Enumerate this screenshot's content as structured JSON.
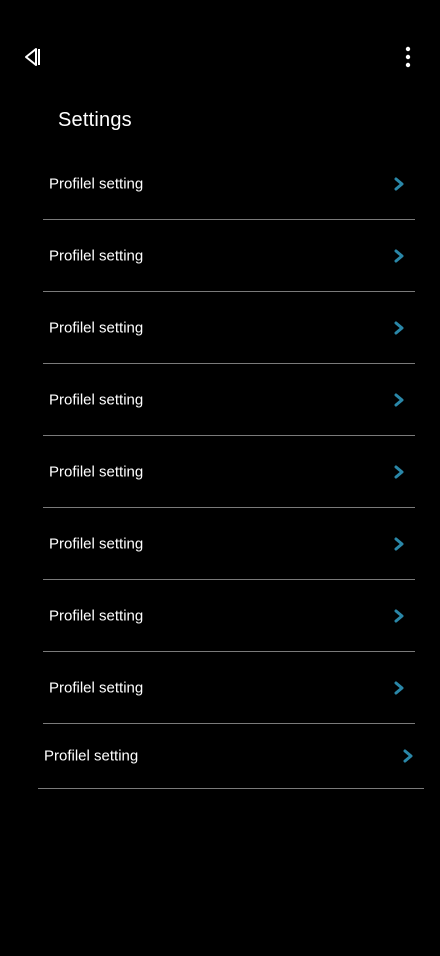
{
  "header": {
    "title": "Settings",
    "back_icon": "back-icon",
    "more_icon": "more-vertical-icon"
  },
  "settings": {
    "items": [
      {
        "label": "Profilel setting"
      },
      {
        "label": "Profilel setting"
      },
      {
        "label": "Profilel setting"
      },
      {
        "label": "Profilel setting"
      },
      {
        "label": "Profilel setting"
      },
      {
        "label": "Profilel setting"
      },
      {
        "label": "Profilel setting"
      },
      {
        "label": "Profilel setting"
      },
      {
        "label": "Profilel setting"
      }
    ]
  },
  "colors": {
    "background": "#000000",
    "text": "#ffffff",
    "accent": "#2a87a8",
    "divider": "#7a7a7a"
  }
}
